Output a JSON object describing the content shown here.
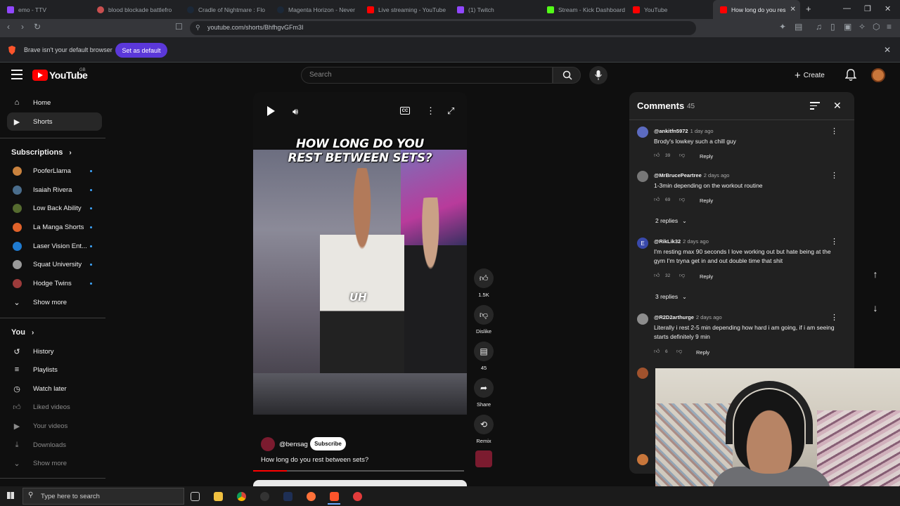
{
  "browser": {
    "tabs": [
      {
        "label": "emo - TTV",
        "active": false
      },
      {
        "label": "blood blockade battlefro",
        "active": false
      },
      {
        "label": "Cradle of Nightmare : Flo",
        "active": false
      },
      {
        "label": "Magenta Horizon - Never",
        "active": false
      },
      {
        "label": "Live streaming - YouTube",
        "active": false
      },
      {
        "label": "(1) Twitch",
        "active": false
      },
      {
        "label": "Stream - Kick Dashboard",
        "active": false
      },
      {
        "label": "YouTube",
        "active": false
      },
      {
        "label": "How long do you res",
        "active": true
      }
    ],
    "new_tab": "+",
    "url": "youtube.com/shorts/BhfhgvGFm3I",
    "infobar_text": "Brave isn't your default browser",
    "set_default_label": "Set as default",
    "accent": "#5b38d9"
  },
  "youtube": {
    "logo_text": "YouTube",
    "region": "GB",
    "search_placeholder": "Search",
    "create_label": "Create",
    "brand_color": "#ff0000"
  },
  "sidebar": {
    "main": [
      {
        "label": "Home",
        "icon": "home-icon"
      },
      {
        "label": "Shorts",
        "icon": "shorts-icon",
        "selected": true
      }
    ],
    "subscriptions_title": "Subscriptions",
    "subscriptions": [
      {
        "label": "PooferLlama",
        "color": "#c9823e"
      },
      {
        "label": "Isaiah Rivera",
        "color": "#4a6d8c"
      },
      {
        "label": "Low Back Ability",
        "color": "#556b2f"
      },
      {
        "label": "La Manga Shorts",
        "color": "#e0622a"
      },
      {
        "label": "Laser Vision Ent...",
        "color": "#1f7bd1"
      },
      {
        "label": "Squat University",
        "color": "#9a9a9a"
      },
      {
        "label": "Hodge Twins",
        "color": "#9c3b3b"
      }
    ],
    "show_more": "Show more",
    "you_title": "You",
    "you_items": [
      {
        "label": "History",
        "icon": "history-icon"
      },
      {
        "label": "Playlists",
        "icon": "playlists-icon"
      },
      {
        "label": "Watch later",
        "icon": "watch-later-icon"
      },
      {
        "label": "Liked videos",
        "icon": "like-icon"
      },
      {
        "label": "Your videos",
        "icon": "your-videos-icon"
      },
      {
        "label": "Downloads",
        "icon": "download-icon"
      },
      {
        "label": "Show more",
        "icon": "chevron-down-icon"
      }
    ]
  },
  "video": {
    "overlay_title_line1": "HOW LONG DO YOU",
    "overlay_title_line2": "REST BETWEEN SETS?",
    "caption": "UH",
    "creator": "@bensag",
    "subscribe_label": "Subscribe",
    "description": "How long do you rest between sets?",
    "progress": 0.16
  },
  "actions": {
    "likes": "1.5K",
    "dislike_label": "Dislike",
    "comments": "45",
    "share_label": "Share",
    "remix_label": "Remix"
  },
  "comments": {
    "title": "Comments",
    "count": "45",
    "items": [
      {
        "user": "@ankitfn5972",
        "time": "1 day ago",
        "text": "Brody's lowkey such a chill guy",
        "likes": "39",
        "reply": "Reply",
        "avatar_color": "#5c6bc0"
      },
      {
        "user": "@MrBrucePeartree",
        "time": "2 days ago",
        "text": "1-3min depending  on the workout routine",
        "likes": "69",
        "reply": "Reply",
        "replies": "2 replies",
        "avatar_color": "#777777"
      },
      {
        "user": "@RikLik32",
        "time": "2 days ago",
        "text": "I'm resting max 90 seconds I love working out but hate being at the gym I'm tryna get in and out double time that shit",
        "likes": "32",
        "reply": "Reply",
        "replies": "3 replies",
        "avatar_color": "#3949ab",
        "avatar_letter": "E"
      },
      {
        "user": "@R2D2arthurge",
        "time": "2 days ago",
        "text": "Literally i rest 2-5 min depending how hard i am going, if i am seeing starts definitely 9 min",
        "likes": "6",
        "reply": "Reply",
        "avatar_color": "#8d8d8d"
      }
    ]
  },
  "taskbar": {
    "search_placeholder": "Type here to search"
  }
}
